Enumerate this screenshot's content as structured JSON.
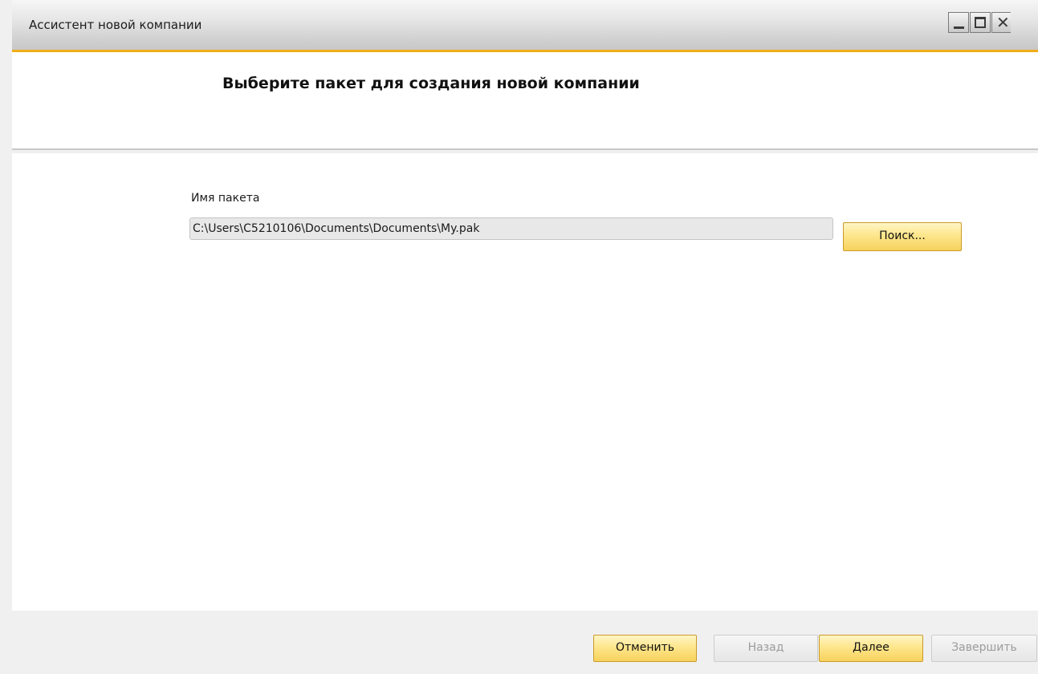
{
  "window": {
    "title": "Ассистент новой компании",
    "controls": {
      "minimize": "minimize-icon",
      "maximize": "maximize-icon",
      "close": "close-icon"
    }
  },
  "header": {
    "heading": "Выберите пакет для создания новой компании"
  },
  "form": {
    "package_label": "Имя пакета",
    "package_path": "C:\\Users\\C5210106\\Documents\\Documents\\My.pak",
    "search_label": "Поиск..."
  },
  "footer": {
    "cancel_label": "Отменить",
    "back_label": "Назад",
    "next_label": "Далее",
    "finish_label": "Завершить"
  },
  "colors": {
    "accent": "#f0ad18",
    "button_face": "#fde68c",
    "button_border": "#c99a2a",
    "disabled_text": "#9c9c9c"
  }
}
